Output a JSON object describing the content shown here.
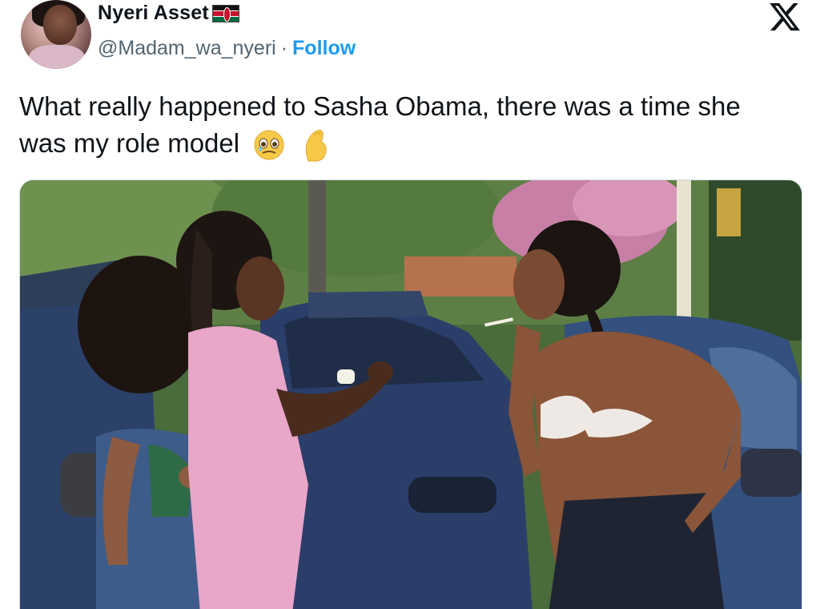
{
  "tweet": {
    "display_name": "Nyeri Asset",
    "name_flag_icon": "kenya-flag-icon",
    "handle": "@Madam_wa_nyeri",
    "separator": "·",
    "follow_label": "Follow",
    "text": "What really happened to Sasha Obama, there was a time she was my role model",
    "text_emojis": [
      "face-holding-back-tears-emoji",
      "pinched-fingers-emoji"
    ],
    "platform_logo": "x-logo-icon"
  },
  "colors": {
    "accent": "#1d9bf0",
    "text_primary": "#0f1419",
    "text_secondary": "#536471"
  }
}
